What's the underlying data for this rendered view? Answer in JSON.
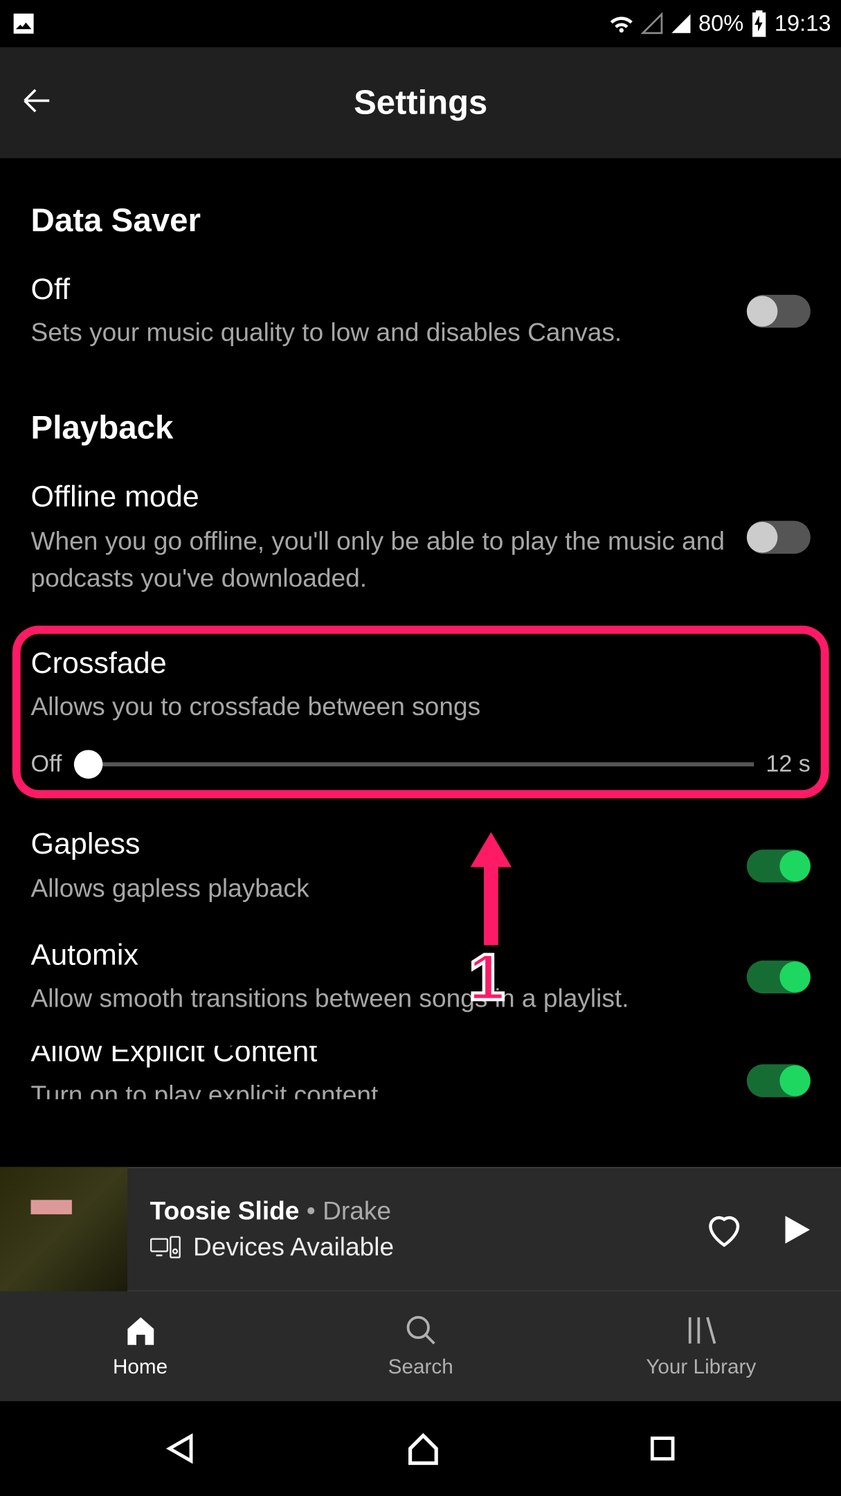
{
  "status": {
    "battery": "80%",
    "time": "19:13"
  },
  "header": {
    "title": "Settings"
  },
  "sections": {
    "data_saver": {
      "title": "Data Saver",
      "item": {
        "title": "Off",
        "desc": "Sets your music quality to low and disables Canvas.",
        "on": false
      }
    },
    "playback": {
      "title": "Playback",
      "offline": {
        "title": "Offline mode",
        "desc": "When you go offline, you'll only be able to play the music and podcasts you've downloaded.",
        "on": false
      },
      "crossfade": {
        "title": "Crossfade",
        "desc": "Allows you to crossfade between songs",
        "min_label": "Off",
        "max_label": "12 s"
      },
      "gapless": {
        "title": "Gapless",
        "desc": "Allows gapless playback",
        "on": true
      },
      "automix": {
        "title": "Automix",
        "desc": "Allow smooth transitions between songs in a playlist.",
        "on": true
      },
      "explicit": {
        "title": "Allow Explicit Content",
        "desc": "Turn on to play explicit content",
        "on": true
      }
    }
  },
  "annotation": {
    "number": "1"
  },
  "now_playing": {
    "track": "Toosie Slide",
    "separator": " • ",
    "artist": "Drake",
    "devices": "Devices Available"
  },
  "nav": {
    "home": "Home",
    "search": "Search",
    "library": "Your Library"
  }
}
